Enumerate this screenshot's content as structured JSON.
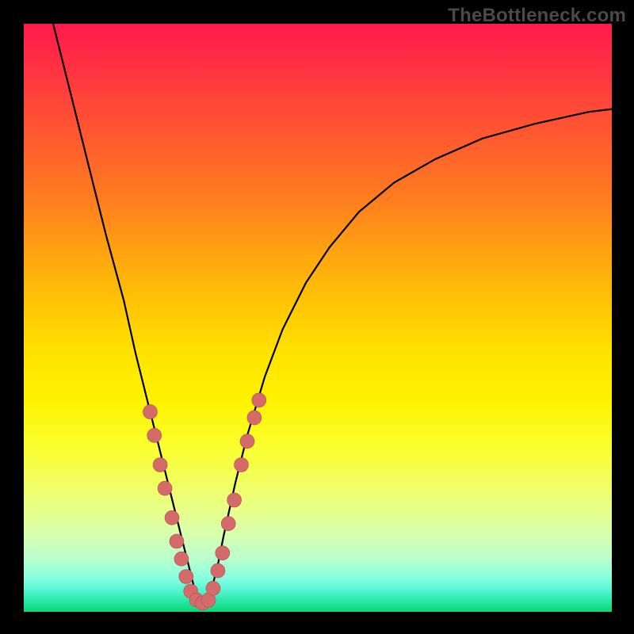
{
  "watermark": "TheBottleneck.com",
  "chart_data": {
    "type": "line",
    "title": "",
    "xlabel": "",
    "ylabel": "",
    "xlim": [
      0,
      100
    ],
    "ylim": [
      0,
      100
    ],
    "grid": false,
    "series": [
      {
        "name": "curve",
        "x": [
          5,
          8,
          11,
          14,
          17,
          19,
          21,
          22.5,
          24,
          25.5,
          27,
          28,
          29,
          30,
          31,
          32,
          33,
          34,
          36,
          38,
          41,
          44,
          48,
          52,
          57,
          63,
          70,
          78,
          87,
          96,
          100
        ],
        "y": [
          100,
          88,
          76,
          64,
          53,
          44,
          36,
          30,
          24,
          18,
          12,
          8,
          4,
          1.5,
          1.5,
          4,
          8,
          13,
          22,
          30,
          40,
          48,
          56,
          62,
          68,
          73,
          77,
          80.5,
          83,
          85,
          85.5
        ]
      }
    ],
    "markers": {
      "name": "highlighted-points",
      "color": "#d46a6a",
      "points": [
        {
          "x": 21.5,
          "y": 34
        },
        {
          "x": 22.2,
          "y": 30
        },
        {
          "x": 23.2,
          "y": 25
        },
        {
          "x": 24.0,
          "y": 21
        },
        {
          "x": 25.2,
          "y": 16
        },
        {
          "x": 26.0,
          "y": 12
        },
        {
          "x": 26.8,
          "y": 9
        },
        {
          "x": 27.6,
          "y": 6
        },
        {
          "x": 28.4,
          "y": 3.5
        },
        {
          "x": 29.4,
          "y": 2
        },
        {
          "x": 30.4,
          "y": 1.5
        },
        {
          "x": 31.4,
          "y": 2
        },
        {
          "x": 32.2,
          "y": 4
        },
        {
          "x": 33.0,
          "y": 7
        },
        {
          "x": 33.8,
          "y": 10
        },
        {
          "x": 34.8,
          "y": 15
        },
        {
          "x": 35.8,
          "y": 19
        },
        {
          "x": 37.0,
          "y": 25
        },
        {
          "x": 38.0,
          "y": 29
        },
        {
          "x": 39.2,
          "y": 33
        },
        {
          "x": 40.0,
          "y": 36
        }
      ]
    }
  }
}
